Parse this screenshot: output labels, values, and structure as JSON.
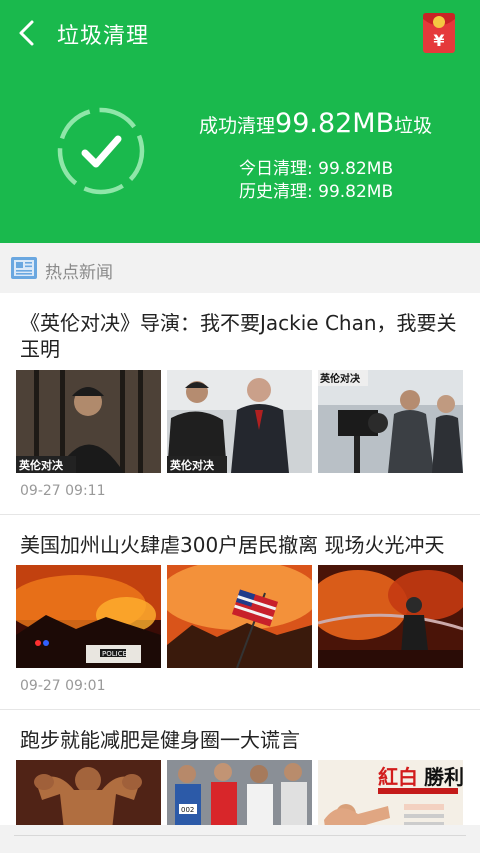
{
  "header": {
    "title": "垃圾清理",
    "result_prefix": "成功清理",
    "result_amount": "99.82MB",
    "result_suffix": "垃圾",
    "today_label": "今日清理: 99.82MB",
    "history_label": "历史清理: 99.82MB",
    "colors": {
      "background": "#1ab94d",
      "text": "#ffffff"
    },
    "icons": {
      "back": "chevron-left-icon",
      "redpacket": "red-envelope-icon",
      "done": "checkmark-circle-icon"
    }
  },
  "section": {
    "title": "热点新闻",
    "icon": "newspaper-icon"
  },
  "news": [
    {
      "title": "《英伦对决》导演：我不要Jackie Chan，我要关玉明",
      "time": "09-27 09:11"
    },
    {
      "title": "美国加州山火肆虐300户居民撤离 现场火光冲天",
      "time": "09-27 09:01"
    },
    {
      "title": "跑步就能减肥是健身圈一大谎言",
      "time": ""
    }
  ]
}
